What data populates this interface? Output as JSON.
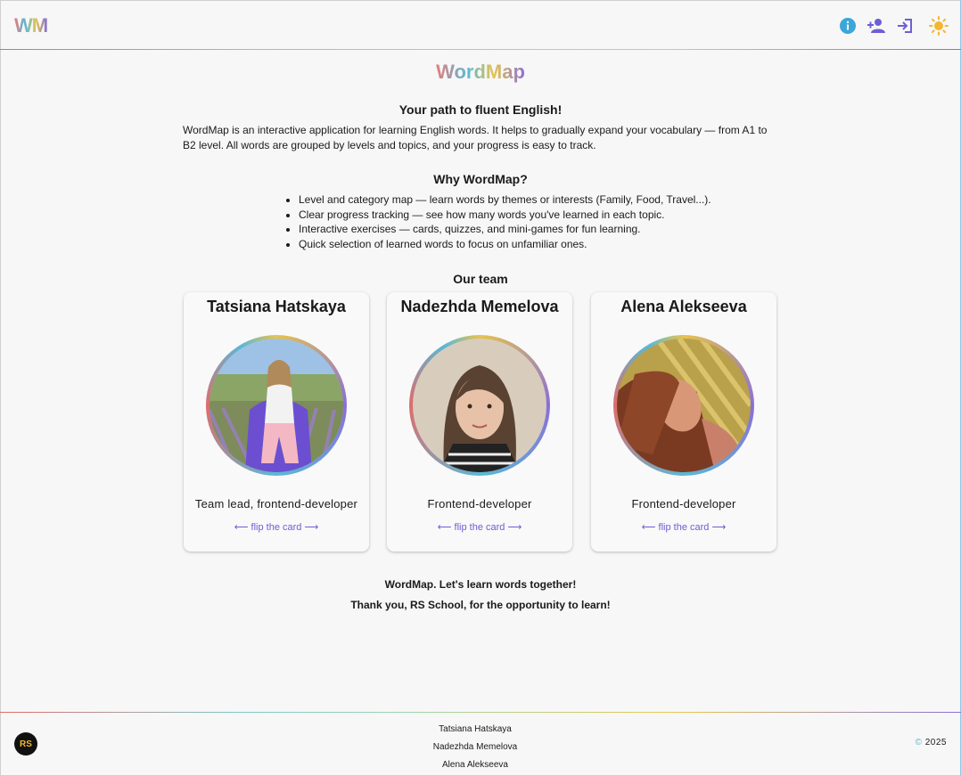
{
  "header": {
    "logo": "WM",
    "icons": [
      "info-icon",
      "add-user-icon",
      "login-icon",
      "sun-icon"
    ],
    "colors": {
      "info": "#3aa7d8",
      "accent": "#6c5fd4",
      "sun": "#f2b630"
    }
  },
  "main": {
    "brand": "WordMap",
    "tagline": "Your path to fluent English!",
    "intro": "WordMap is an interactive application for learning English words. It helps to gradually expand your vocabulary — from A1 to B2 level. All words are grouped by levels and topics, and your progress is easy to track.",
    "why_heading": "Why WordMap?",
    "features": [
      "Level and category map — learn words by themes or interests (Family, Food, Travel...).",
      "Clear progress tracking — see how many words you've learned in each topic.",
      "Interactive exercises — cards, quizzes, and mini-games for fun learning.",
      "Quick selection of learned words to focus on unfamiliar ones."
    ],
    "team_heading": "Our team",
    "team": [
      {
        "name": "Tatsiana Hatskaya",
        "role": "Team lead, frontend-developer",
        "flip": "⟵ flip the card ⟶"
      },
      {
        "name": "Nadezhda Memelova",
        "role": "Frontend-developer",
        "flip": "⟵ flip the card ⟶"
      },
      {
        "name": "Alena Alekseeva",
        "role": "Frontend-developer",
        "flip": "⟵ flip the card ⟶"
      }
    ],
    "closing_1": "WordMap. Let's learn words together!",
    "closing_2": "Thank you, RS School, for the opportunity to learn!"
  },
  "footer": {
    "rs_logo": "RS",
    "names": [
      "Tatsiana Hatskaya",
      "Nadezhda Memelova",
      "Alena Alekseeva"
    ],
    "copyright_symbol": "©",
    "year": "2025"
  }
}
